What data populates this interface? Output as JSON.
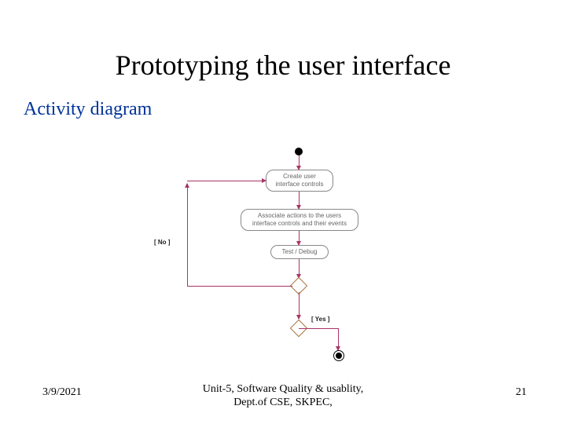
{
  "title": "Prototyping the user interface",
  "subtitle": "Activity diagram",
  "diagram": {
    "activity1": "Create user\ninterface controls",
    "activity2": "Associate actions to the users\ninterface controls and their events",
    "activity3": "Test / Debug",
    "branch_no": "[ No ]",
    "branch_yes": "[ Yes ]"
  },
  "footer": {
    "date": "3/9/2021",
    "center": "Unit-5, Software Quality & usablity,\nDept.of CSE, SKPEC,",
    "page": "21"
  }
}
